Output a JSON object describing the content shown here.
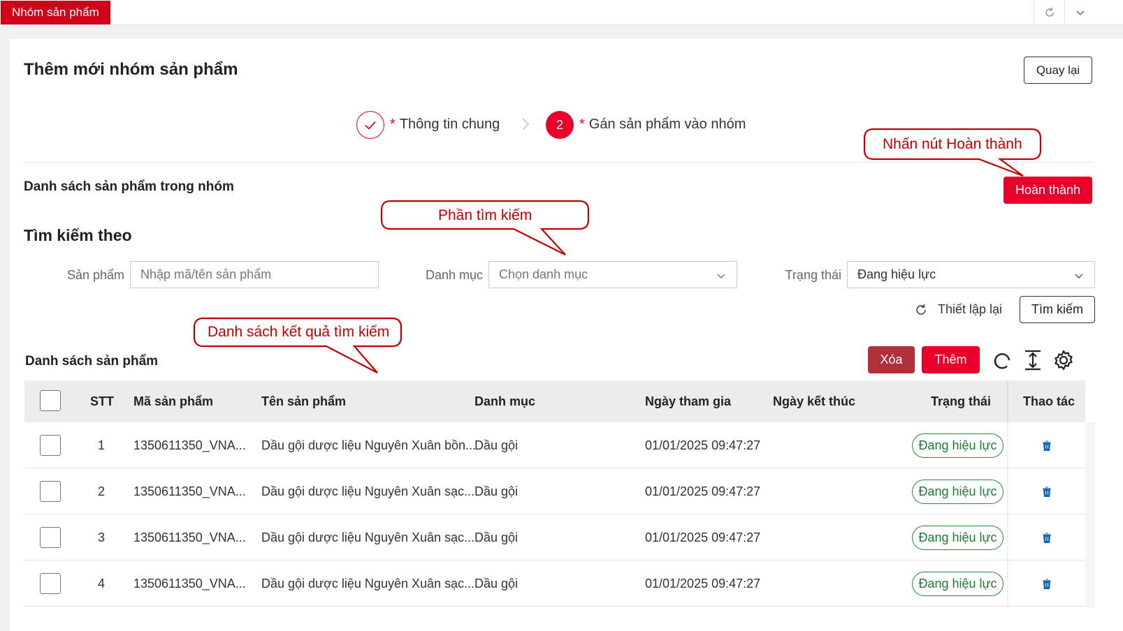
{
  "tabbar": {
    "active_tab": "Nhóm sản phẩm",
    "refresh_icon": "refresh-icon",
    "menu_icon": "chevron-down-icon"
  },
  "page": {
    "title": "Thêm mới nhóm sản phẩm",
    "back_button": "Quay lại"
  },
  "steps": [
    {
      "label": "Thông tin chung",
      "marker": "",
      "required": "*",
      "state": "done"
    },
    {
      "label": "Gán sản phẩm vào nhóm",
      "marker": "2",
      "required": "*",
      "state": "current"
    }
  ],
  "group_section": {
    "title": "Danh sách sản phẩm trong nhóm",
    "finish_button": "Hoàn thành"
  },
  "search": {
    "title": "Tìm kiếm theo",
    "product_label": "Sản phẩm",
    "product_placeholder": "Nhập mã/tên sản phẩm",
    "category_label": "Danh mục",
    "category_placeholder": "Chọn danh mục",
    "status_label": "Trạng thái",
    "status_value": "Đang hiệu lực",
    "reset_button": "Thiết lập lại",
    "search_button": "Tìm kiếm"
  },
  "product_list": {
    "title": "Danh sách sản phẩm",
    "delete_button": "Xóa",
    "add_button": "Thêm",
    "columns": [
      "STT",
      "Mã sản phẩm",
      "Tên sản phẩm",
      "Danh mục",
      "Ngày tham gia",
      "Ngày kết thúc",
      "Trạng thái",
      "Thao tác"
    ],
    "rows": [
      {
        "stt": "1",
        "code": "1350611350_VNA...",
        "name": "Dầu gội dược liệu Nguyên Xuân bồn...",
        "category": "Dầu gội",
        "joined": "01/01/2025 09:47:27",
        "ended": "",
        "status": "Đang hiệu lực"
      },
      {
        "stt": "2",
        "code": "1350611350_VNA...",
        "name": "Dầu gội dược liệu Nguyên Xuân sạc...",
        "category": "Dầu gội",
        "joined": "01/01/2025 09:47:27",
        "ended": "",
        "status": "Đang hiệu lực"
      },
      {
        "stt": "3",
        "code": "1350611350_VNA...",
        "name": "Dầu gội dược liệu Nguyên Xuân sạc...",
        "category": "Dầu gội",
        "joined": "01/01/2025 09:47:27",
        "ended": "",
        "status": "Đang hiệu lực"
      },
      {
        "stt": "4",
        "code": "1350611350_VNA...",
        "name": "Dầu gội dược liệu Nguyên Xuân sạc...",
        "category": "Dầu gội",
        "joined": "01/01/2025 09:47:27",
        "ended": "",
        "status": "Đang hiệu lực"
      }
    ]
  },
  "annotations": {
    "finish_hint": "Nhấn nút Hoàn thành",
    "search_hint": "Phần tìm kiếm",
    "results_hint": "Danh sách kết quả tìm kiếm"
  },
  "colors": {
    "brand_red": "#e8002a",
    "tab_red": "#d0021b",
    "delete_red": "#b0303a",
    "status_green": "#1f7a34",
    "trash_blue": "#1565c0",
    "callout_red": "#c00000"
  }
}
